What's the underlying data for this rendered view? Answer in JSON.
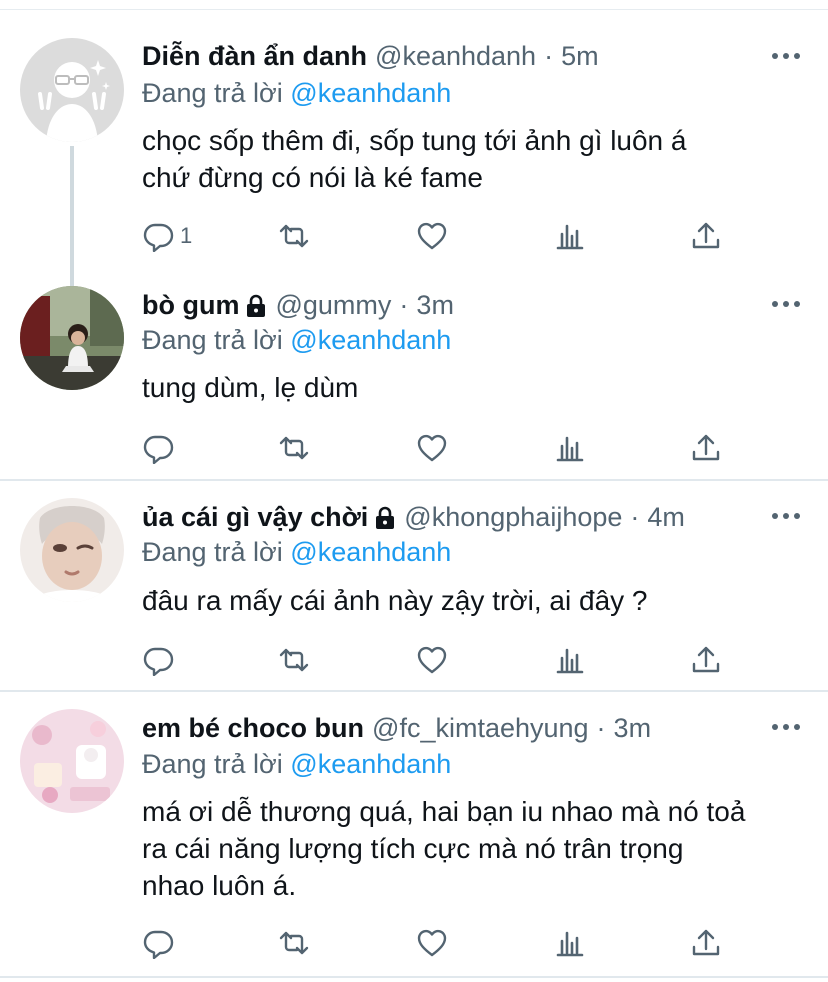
{
  "reply_prefix": "Đang trả lời",
  "tweets": [
    {
      "name": "Diễn đàn ẩn danh",
      "handle": "@keanhdanh",
      "separator": "·",
      "time": "5m",
      "locked": false,
      "reply_to": "@keanhdanh",
      "text_lines": [
        "chọc sốp thêm đi, sốp tung tới ảnh gì luôn á",
        "chứ đừng có nói là ké fame"
      ],
      "reply_count": "1"
    },
    {
      "name": "bò gum",
      "handle": "@gummy",
      "separator": "·",
      "time": "3m",
      "locked": true,
      "reply_to": "@keanhdanh",
      "text_lines": [
        "tung dùm, lẹ dùm"
      ],
      "reply_count": ""
    },
    {
      "name": "ủa cái gì vậy chời",
      "handle": "@khongphaijhope",
      "separator": "·",
      "time": "4m",
      "locked": true,
      "reply_to": "@keanhdanh",
      "text_lines": [
        "đâu ra mấy cái ảnh này zậy trời, ai đây ?"
      ],
      "reply_count": ""
    },
    {
      "name": "em bé choco bun",
      "handle": "@fc_kimtaehyung",
      "separator": "·",
      "time": "3m",
      "locked": false,
      "reply_to": "@keanhdanh",
      "text_lines": [
        "má ơi dễ thương quá, hai bạn iu nhao mà nó toả",
        "ra cái năng lượng tích cực mà nó trân trọng",
        "nhao luôn á."
      ],
      "reply_count": ""
    }
  ],
  "icons": {
    "reply": "reply-icon",
    "retweet": "retweet-icon",
    "like": "heart-icon",
    "views": "analytics-icon",
    "share": "share-icon",
    "more": "more-dots-icon",
    "lock": "lock-icon"
  },
  "colors": {
    "text": "#0f1419",
    "secondary": "#536471",
    "mention": "#1d9bf0",
    "divider": "#e1e8ed",
    "thread_line": "#cfd9de"
  }
}
